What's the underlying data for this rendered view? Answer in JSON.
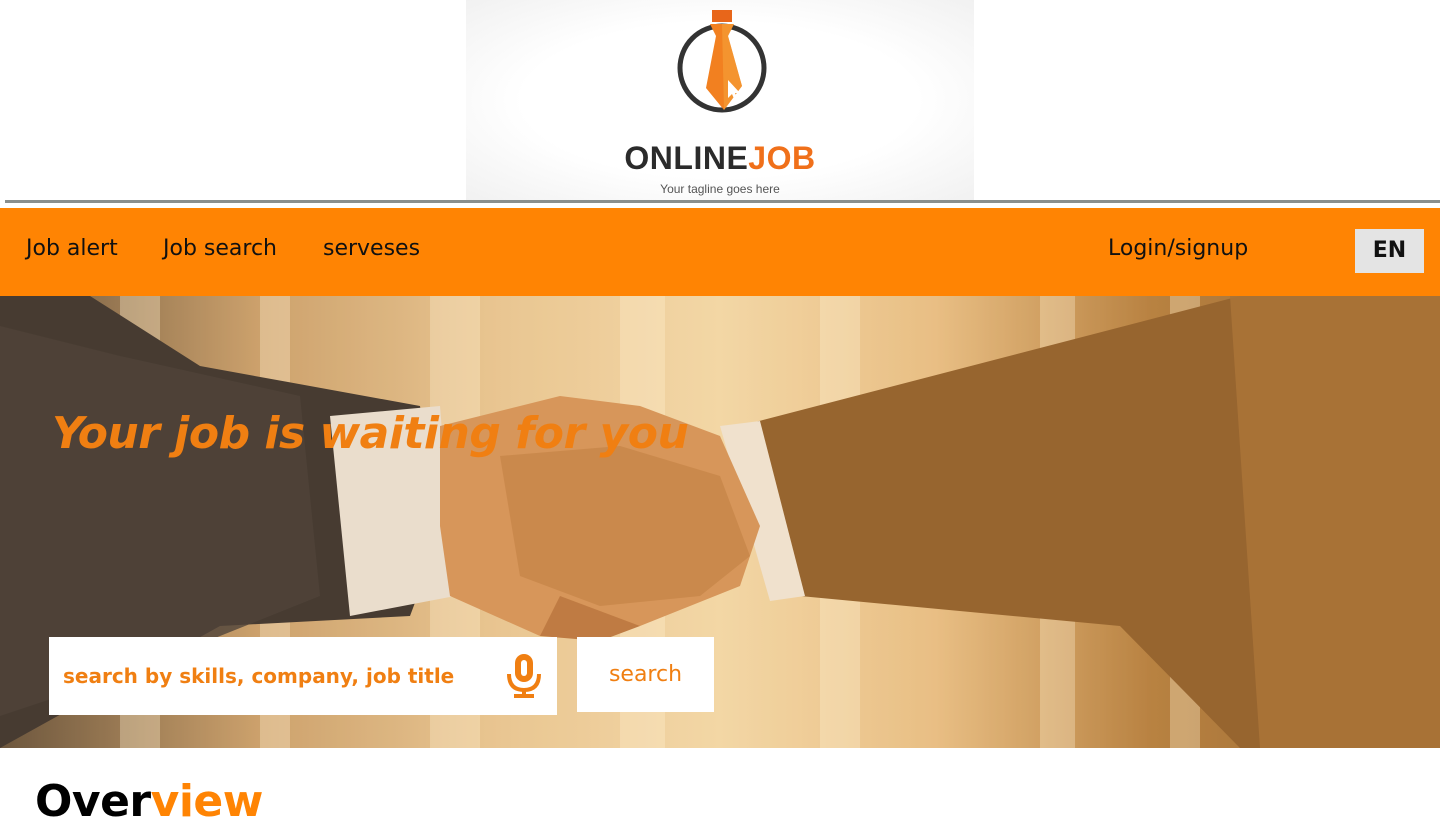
{
  "logo": {
    "word_primary": "ONLINE",
    "word_accent": "JOB",
    "tagline": "Your tagline goes here",
    "icon": "necktie-cursor-icon"
  },
  "nav": {
    "items": [
      {
        "label": "Job alert"
      },
      {
        "label": "Job search"
      },
      {
        "label": "serveses"
      }
    ],
    "login_label": "Login/signup",
    "language": "EN"
  },
  "hero": {
    "title": "Your job is waiting for you",
    "background": "handshake-photo",
    "search_placeholder": "search by skills, company, job title",
    "search_icon": "microphone-icon",
    "search_button": "search"
  },
  "overview": {
    "title_part1": "Over",
    "title_part2": "view"
  },
  "colors": {
    "brand_orange": "#ff8403",
    "accent_text": "#f07f12",
    "nav_text": "#111111",
    "lang_bg": "#e4e4e4"
  }
}
